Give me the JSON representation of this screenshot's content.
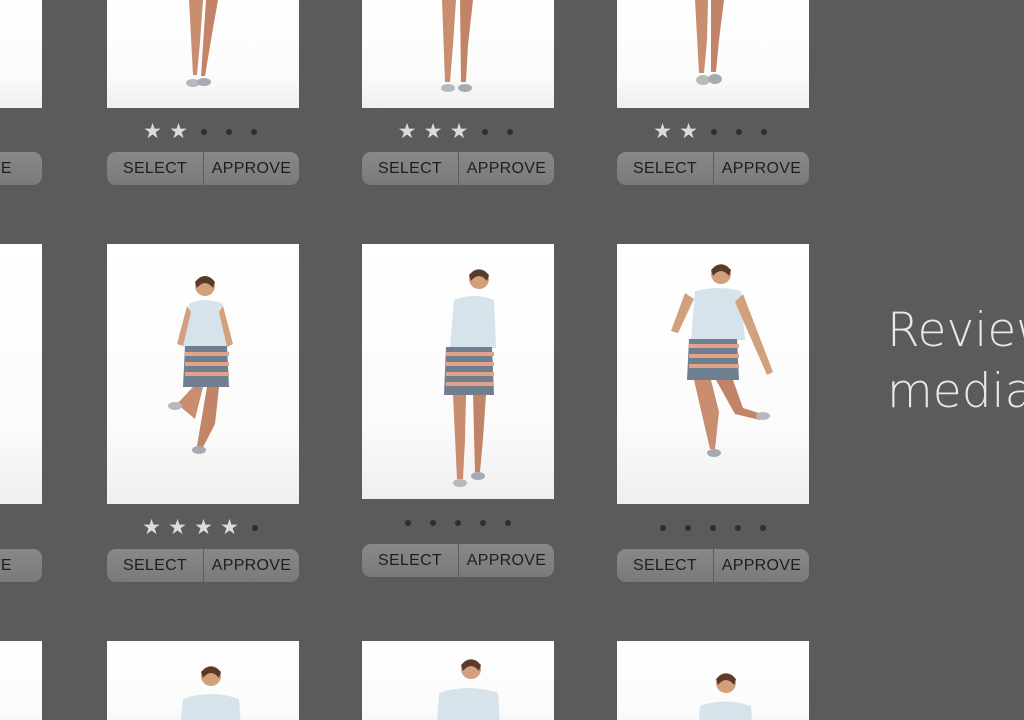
{
  "buttons": {
    "select_label": "SELECT",
    "approve_label": "APPROVE",
    "partial_approve_label": "OVE"
  },
  "headline": {
    "line1": "Review",
    "line2": "media"
  },
  "grid": {
    "row1": [
      {
        "name": "photo-1",
        "rating": 2,
        "max": 5
      },
      {
        "name": "photo-2",
        "rating": 3,
        "max": 5
      },
      {
        "name": "photo-3",
        "rating": 2,
        "max": 5
      }
    ],
    "row2": [
      {
        "name": "photo-4",
        "rating": 4,
        "max": 5
      },
      {
        "name": "photo-5",
        "rating": 0,
        "max": 5
      },
      {
        "name": "photo-6",
        "rating": 0,
        "max": 5
      }
    ]
  },
  "colors": {
    "background": "#5b5b5b",
    "button": "#7e7e7e",
    "star_filled": "#dcdcdc",
    "star_empty": "#2f2f2f",
    "headline_text": "#e8e8e8"
  },
  "icons": {
    "star_filled": "filled-star-icon",
    "star_empty": "empty-rating-dot-icon"
  }
}
